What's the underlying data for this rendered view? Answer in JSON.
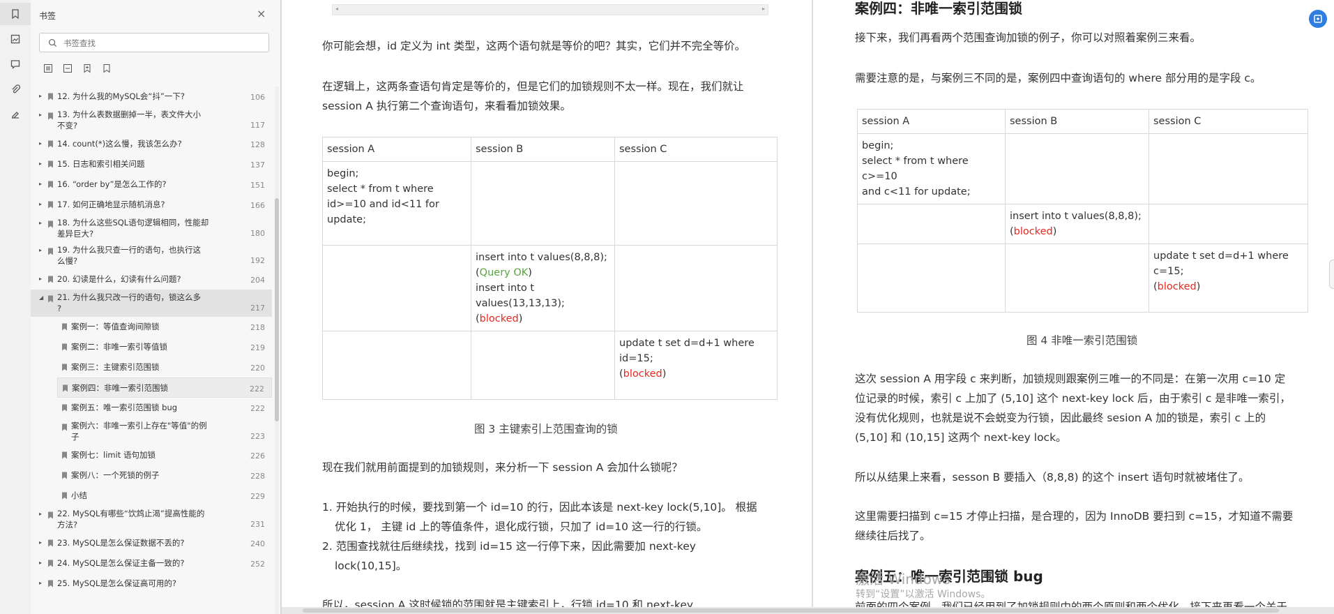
{
  "rail": {
    "icons": [
      "bookmark-icon",
      "thumbnail-icon",
      "comment-icon",
      "attachment-icon",
      "signature-icon"
    ]
  },
  "panel": {
    "title": "书签",
    "search_placeholder": "书签查找",
    "tools": [
      "expand-all-icon",
      "collapse-all-icon",
      "add-bookmark-icon",
      "bookmark-outline-icon"
    ],
    "items": [
      {
        "label": "12. 为什么我的MySQL会“抖”一下?",
        "page": "106",
        "level": 1,
        "arrow": true
      },
      {
        "label": "13. 为什么表数据删掉一半，表文件大小",
        "label2": "不变?",
        "page": "117",
        "level": 1,
        "arrow": true
      },
      {
        "label": "14. count(*)这么慢，我该怎么办?",
        "page": "128",
        "level": 1,
        "arrow": true
      },
      {
        "label": "15. 日志和索引相关问题",
        "page": "137",
        "level": 1,
        "arrow": true
      },
      {
        "label": "16. “order by”是怎么工作的?",
        "page": "151",
        "level": 1,
        "arrow": true
      },
      {
        "label": "17. 如何正确地显示随机消息?",
        "page": "166",
        "level": 1,
        "arrow": true
      },
      {
        "label": "18. 为什么这些SQL语句逻辑相同，性能却",
        "label2": "差异巨大?",
        "page": "180",
        "level": 1,
        "arrow": true
      },
      {
        "label": "19. 为什么我只查一行的语句，也执行这",
        "label2": "么慢?",
        "page": "192",
        "level": 1,
        "arrow": true
      },
      {
        "label": "20. 幻读是什么，幻读有什么问题?",
        "page": "204",
        "level": 1,
        "arrow": true
      },
      {
        "label": "21. 为什么我只改一行的语句，锁这么多",
        "label2": "?",
        "page": "217",
        "level": 1,
        "arrow": true,
        "expanded": true,
        "selected": true
      },
      {
        "label": "案例一：等值查询间隙锁",
        "page": "218",
        "level": 2
      },
      {
        "label": "案例二：非唯一索引等值锁",
        "page": "219",
        "level": 2
      },
      {
        "label": "案例三：主键索引范围锁",
        "page": "220",
        "level": 2
      },
      {
        "label": "案例四：非唯一索引范围锁",
        "page": "222",
        "level": 2,
        "hover": true
      },
      {
        "label": "案例五：唯一索引范围锁 bug",
        "page": "222",
        "level": 2
      },
      {
        "label": "案例六：非唯一索引上存在\"等值\"的例",
        "label2": "子",
        "page": "223",
        "level": 2
      },
      {
        "label": "案例七：limit 语句加锁",
        "page": "226",
        "level": 2
      },
      {
        "label": "案例八：一个死锁的例子",
        "page": "228",
        "level": 2
      },
      {
        "label": "小结",
        "page": "229",
        "level": 2
      },
      {
        "label": "22. MySQL有哪些“饮鸩止渴”提高性能的",
        "label2": "方法?",
        "page": "231",
        "level": 1,
        "arrow": true
      },
      {
        "label": "23. MySQL是怎么保证数据不丢的?",
        "page": "240",
        "level": 1,
        "arrow": true
      },
      {
        "label": "24. MySQL是怎么保证主备一致的?",
        "page": "252",
        "level": 1,
        "arrow": true
      },
      {
        "label": "25. MySQL是怎么保证高可用的?",
        "page": "",
        "level": 1,
        "arrow": true
      }
    ]
  },
  "page1": {
    "p1": "你可能会想，id 定义为 int 类型，这两个语句就是等价的吧？其实，它们并不完全等价。",
    "p2a": "在逻辑上，这两条查语句肯定是等价的，但是它们的加锁规则不太一样。现在，我们就让",
    "p2b": "session A 执行第二个查询语句，来看看加锁效果。",
    "table": {
      "headers": [
        "session A",
        "session B",
        "session C"
      ],
      "a1": [
        "begin;",
        "select * from t where",
        "id>=10 and id<11 for",
        "update;"
      ],
      "b2": [
        "insert into t values(8,8,8);"
      ],
      "b2_ok_pre": "(",
      "b2_ok": "Query OK",
      "b2_ok_post": ")",
      "b2_more": [
        "insert into t",
        "values(13,13,13);"
      ],
      "b2_blk_pre": "(",
      "b2_blk": "blocked",
      "b2_blk_post": ")",
      "c3": [
        "update t set d=d+1 where",
        "id=15;"
      ],
      "c3_blk_pre": "(",
      "c3_blk": "blocked",
      "c3_blk_post": ")"
    },
    "caption": "图 3 主键索引上范围查询的锁",
    "p3": "现在我们就用前面提到的加锁规则，来分析一下 session A 会加什么锁呢？",
    "li1a": "1. 开始执行的时候，要找到第一个 id=10 的行，因此本该是 next-key lock(5,10]。 根据",
    "li1b": "优化 1， 主键 id 上的等值条件，退化成行锁，只加了 id=10 这一行的行锁。",
    "li2a": "2. 范围查找就往后继续找，找到 id=15 这一行停下来，因此需要加 next-key",
    "li2b": "lock(10,15]。",
    "p4": "所以，session A 这时候锁的范围就是主键索引上，行锁 id=10 和 next-key"
  },
  "page2": {
    "h_case4": "案例四：非唯一索引范围锁",
    "p1": "接下来，我们再看两个范围查询加锁的例子，你可以对照着案例三来看。",
    "p2": "需要注意的是，与案例三不同的是，案例四中查询语句的 where 部分用的是字段 c。",
    "table": {
      "headers": [
        "session A",
        "session B",
        "session C"
      ],
      "a1": [
        "begin;",
        "select * from t where c>=10",
        "and c<11 for update;"
      ],
      "b2": [
        "insert into t values(8,8,8);"
      ],
      "b2_blk_pre": "(",
      "b2_blk": "blocked",
      "b2_blk_post": ")",
      "c3": [
        "update t set d=d+1 where",
        "c=15;"
      ],
      "c3_blk_pre": "(",
      "c3_blk": "blocked",
      "c3_blk_post": ")"
    },
    "caption": "图 4 非唯一索引范围锁",
    "p3a": "这次 session A 用字段 c 来判断，加锁规则跟案例三唯一的不同是：在第一次用 c=10 定",
    "p3b": "位记录的时候，索引 c 上加了 (5,10] 这个 next-key lock 后，由于索引 c 是非唯一索引，",
    "p3c": "没有优化规则，也就是说不会蜕变为行锁，因此最终 sesion A 加的锁是，索引 c 上的",
    "p3d": "(5,10] 和 (10,15] 这两个 next-key lock。",
    "p4": "所以从结果上来看，sesson B 要插入（8,8,8) 的这个 insert 语句时就被堵住了。",
    "p5a": "这里需要扫描到 c=15 才停止扫描，是合理的，因为 InnoDB 要扫到 c=15，才知道不需要",
    "p5b": "继续往后找了。",
    "h_case5": "案例五：唯一索引范围锁 bug",
    "p6": "前面的四个案例，我们已经用到了加锁规则中的两个原则和两个优化，接下来再看一个关于"
  },
  "watermark": {
    "line1": "激活 Windows",
    "line2": "转到“设置”以激活 Windows。"
  }
}
